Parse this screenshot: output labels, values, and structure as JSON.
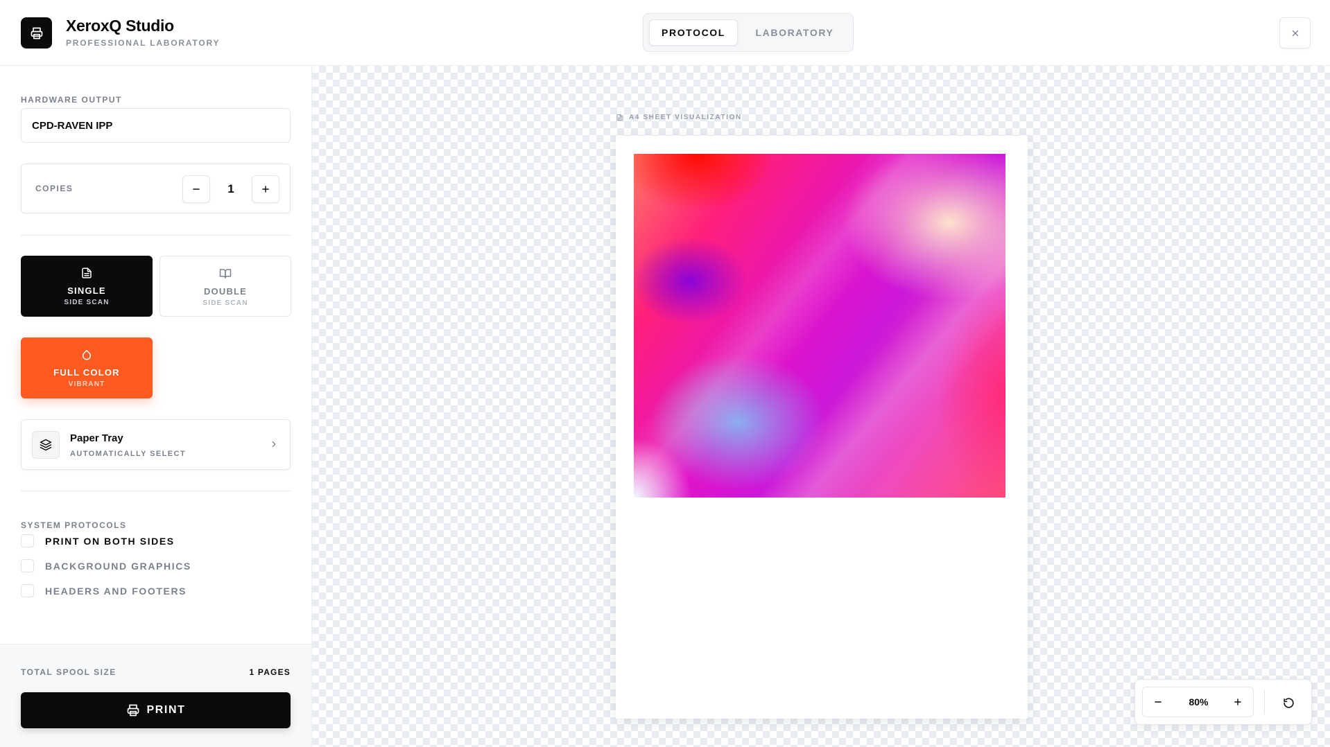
{
  "header": {
    "app_title": "XeroxQ Studio",
    "app_subtitle": "PROFESSIONAL LABORATORY",
    "tabs": [
      {
        "label": "PROTOCOL",
        "active": true
      },
      {
        "label": "LABORATORY",
        "active": false
      }
    ],
    "icons": {
      "logo": "printer-icon",
      "close": "close-icon"
    }
  },
  "sidebar": {
    "hardware_output": {
      "label": "HARDWARE OUTPUT",
      "value": "CPD-RAVEN IPP"
    },
    "copies": {
      "label": "COPIES",
      "value": "1"
    },
    "modes": {
      "single": {
        "title": "SINGLE",
        "subtitle": "SIDE SCAN",
        "selected": true,
        "icon": "document-icon"
      },
      "double": {
        "title": "DOUBLE",
        "subtitle": "SIDE SCAN",
        "selected": false,
        "icon": "book-icon"
      },
      "color": {
        "title": "FULL COLOR",
        "subtitle": "VIBRANT",
        "selected": true,
        "icon": "droplet-icon"
      }
    },
    "paper_tray": {
      "title": "Paper Tray",
      "subtitle": "AUTOMATICALLY SELECT",
      "icon": "layers-icon"
    },
    "system_protocols": {
      "label": "SYSTEM PROTOCOLS",
      "items": [
        {
          "label": "PRINT ON BOTH SIDES",
          "checked": false
        },
        {
          "label": "BACKGROUND GRAPHICS",
          "checked": false
        },
        {
          "label": "HEADERS AND FOOTERS",
          "checked": false
        }
      ]
    },
    "footer": {
      "spool_label": "TOTAL SPOOL SIZE",
      "spool_value": "1 PAGES",
      "print_label": "PRINT"
    }
  },
  "canvas": {
    "viz_label": "A4 SHEET VISUALIZATION",
    "zoom": "80%"
  },
  "colors": {
    "accent": "#ff5a1f",
    "primary": "#0b0b0d",
    "muted": "#7c828d"
  }
}
